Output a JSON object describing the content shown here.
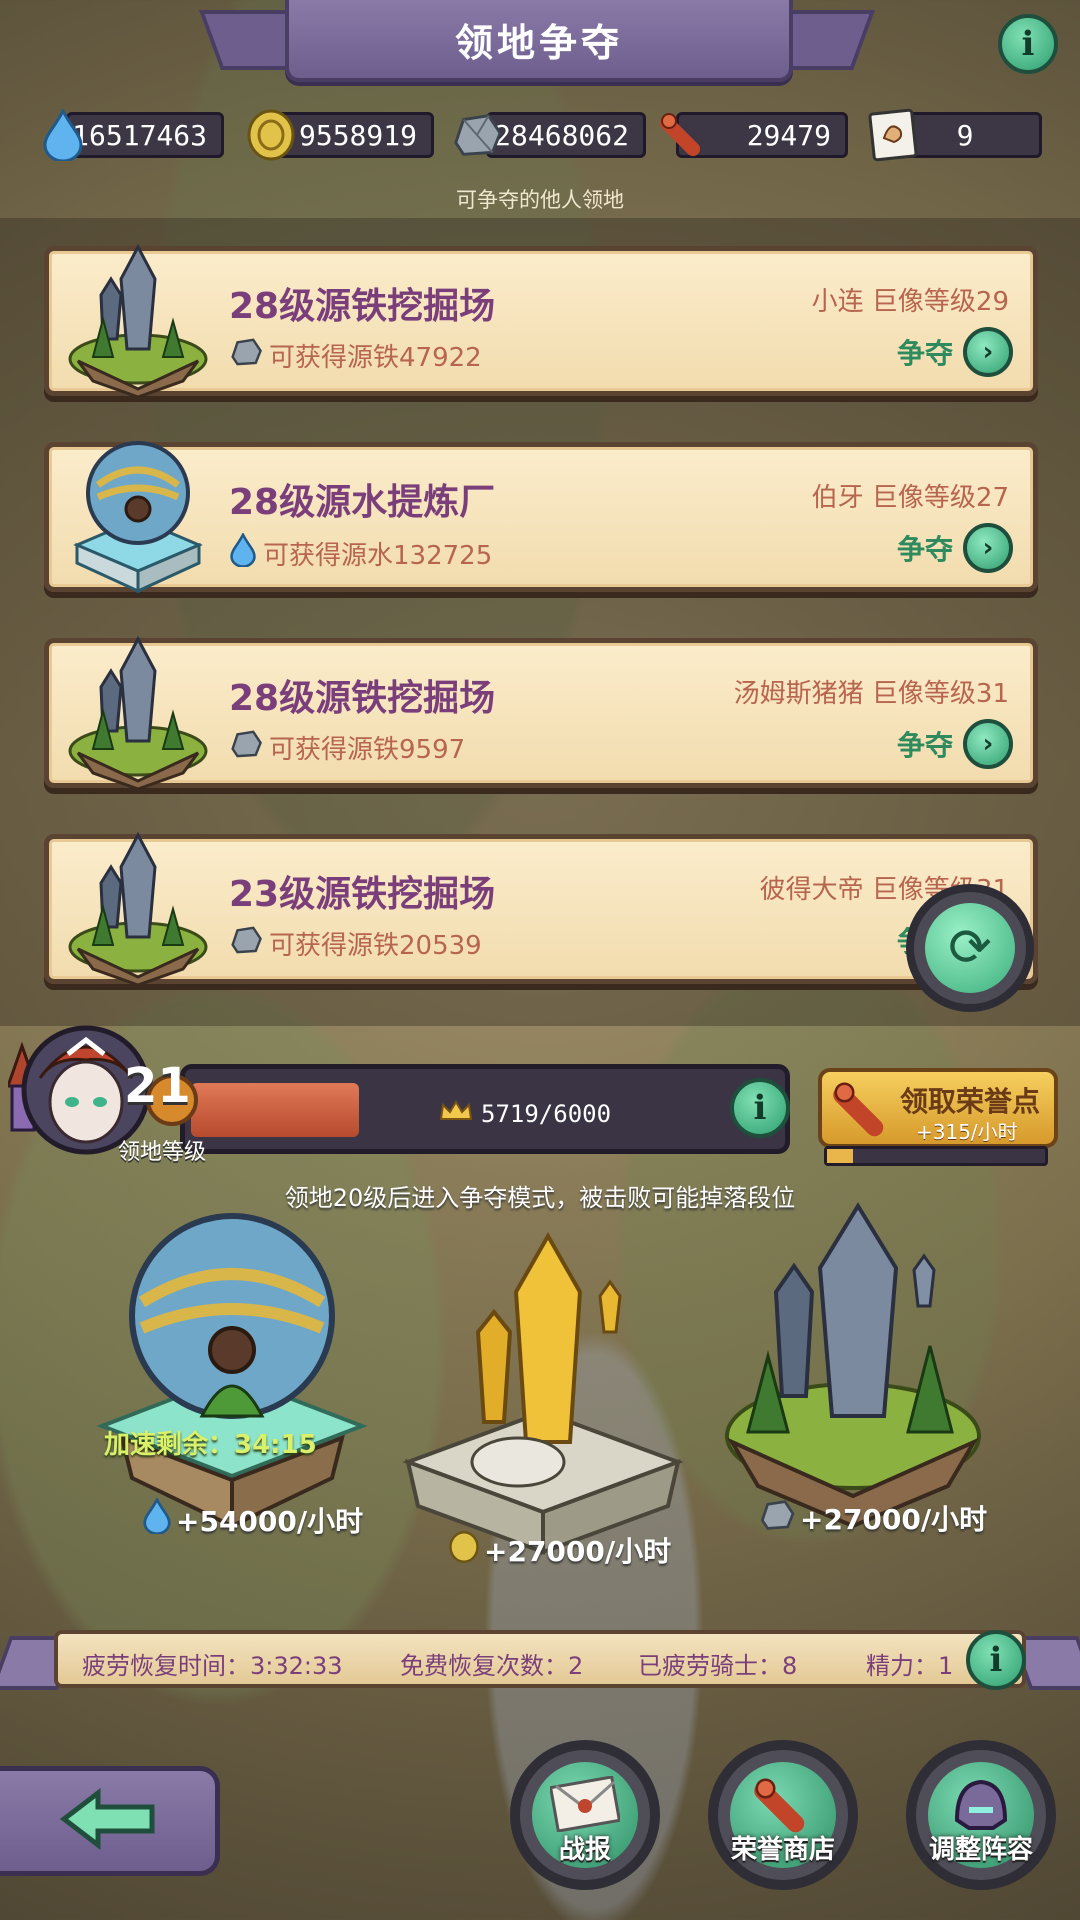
{
  "header": {
    "title": "领地争夺"
  },
  "resources": [
    {
      "icon": "water-drop-icon",
      "value": "16517463"
    },
    {
      "icon": "gold-coin-icon",
      "value": "9558919"
    },
    {
      "icon": "iron-ore-icon",
      "value": "28468062"
    },
    {
      "icon": "scroll-icon",
      "value": "29479"
    },
    {
      "icon": "strength-card-icon",
      "value": "9"
    }
  ],
  "subtitle": "可争夺的他人领地",
  "territories": [
    {
      "title": "28级源铁挖掘场",
      "reward": "可获得源铁47922",
      "reward_icon": "iron-ore-icon",
      "owner": "小连  巨像等级29",
      "action": "争夺"
    },
    {
      "title": "28级源水提炼厂",
      "reward": "可获得源水132725",
      "reward_icon": "water-drop-icon",
      "owner": "伯牙  巨像等级27",
      "action": "争夺"
    },
    {
      "title": "28级源铁挖掘场",
      "reward": "可获得源铁9597",
      "reward_icon": "iron-ore-icon",
      "owner": "汤姆斯猪猪  巨像等级31",
      "action": "争夺"
    },
    {
      "title": "23级源铁挖掘场",
      "reward": "可获得源铁20539",
      "reward_icon": "iron-ore-icon",
      "owner": "彼得大帝  巨像等级31",
      "action": "争夺"
    }
  ],
  "level": {
    "number": "21",
    "label": "领地等级",
    "xp_text": "5719/6000",
    "xp_fraction": 0.953
  },
  "honor": {
    "title": "领取荣誉点",
    "rate": "+315/小时",
    "progress_fraction": 0.12
  },
  "notice": "领地20级后进入争夺模式，被击败可能掉落段位",
  "islands": [
    {
      "boost": "加速剩余：34:15",
      "rate": "+54000/小时",
      "icon": "water-drop-icon"
    },
    {
      "rate": "+27000/小时",
      "icon": "gold-coin-icon"
    },
    {
      "rate": "+27000/小时",
      "icon": "iron-ore-icon"
    }
  ],
  "status": {
    "fatigue_recovery": "疲劳恢复时间：3:32:33",
    "free_recovery": "免费恢复次数：2",
    "tired_knights": "已疲劳骑士：8",
    "energy": "精力：1"
  },
  "bottom": {
    "battle_report": "战报",
    "honor_shop": "荣誉商店",
    "adjust_lineup": "调整阵容"
  },
  "colors": {
    "accent_green": "#2f9f6f",
    "title_purple": "#7a3f7a",
    "card_bg": "#fbeccb"
  }
}
